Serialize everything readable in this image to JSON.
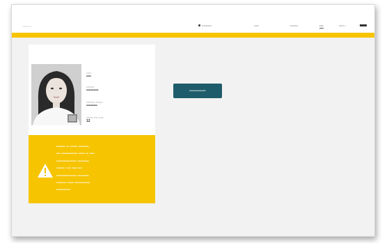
{
  "header": {
    "brand": "•••••• ••",
    "nav": [
      "••••••••••",
      "•••••",
      "••••••••",
      "••••",
      "••••• •",
      ""
    ]
  },
  "profile": {
    "fields": [
      {
        "label": "•••••",
        "value": "••••"
      },
      {
        "label": "••••••••",
        "value": "••••••••••"
      },
      {
        "label": "••••••••• •••••••",
        "value": "•••••••••"
      },
      {
        "label": "••••••• •••• •••••",
        "value": "12"
      }
    ]
  },
  "warning": {
    "icon": "warning-icon",
    "lines": [
      "••••••• •• •••••• ••••••••,",
      "••• ••••••••••••• ••••• •• ••••",
      "•••••••••••••••• •••••••••",
      "•••••• • ••• •••• •••",
      "•••••••••••••••• •••••••••",
      "•••••••• ••••• ••••••••••••",
      "•••••••••••"
    ]
  },
  "action": {
    "label": "••••••••••••"
  },
  "colors": {
    "accent": "#f6c400",
    "button": "#1f5c6b",
    "background": "#f2f2f2"
  }
}
